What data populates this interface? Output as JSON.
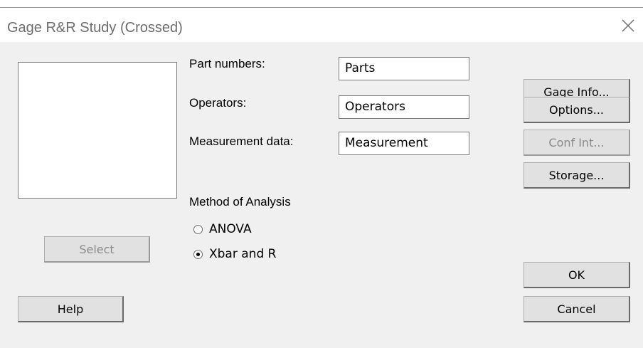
{
  "window": {
    "title": "Gage R&R Study (Crossed)"
  },
  "fields": {
    "part_numbers": {
      "label": "Part numbers:",
      "value": "Parts"
    },
    "operators": {
      "label": "Operators:",
      "value": "Operators"
    },
    "measurement_data": {
      "label": "Measurement data:",
      "value": "Measurement"
    }
  },
  "method": {
    "label": "Method of Analysis",
    "options": [
      {
        "label": "ANOVA",
        "selected": false
      },
      {
        "label": "Xbar and R",
        "selected": true
      }
    ]
  },
  "buttons": {
    "select": "Select",
    "help": "Help",
    "gage_info": "Gage Info...",
    "options": "Options...",
    "conf_int": "Conf Int...",
    "storage": "Storage...",
    "ok": "OK",
    "cancel": "Cancel"
  },
  "icons": {
    "close": "close-icon"
  }
}
